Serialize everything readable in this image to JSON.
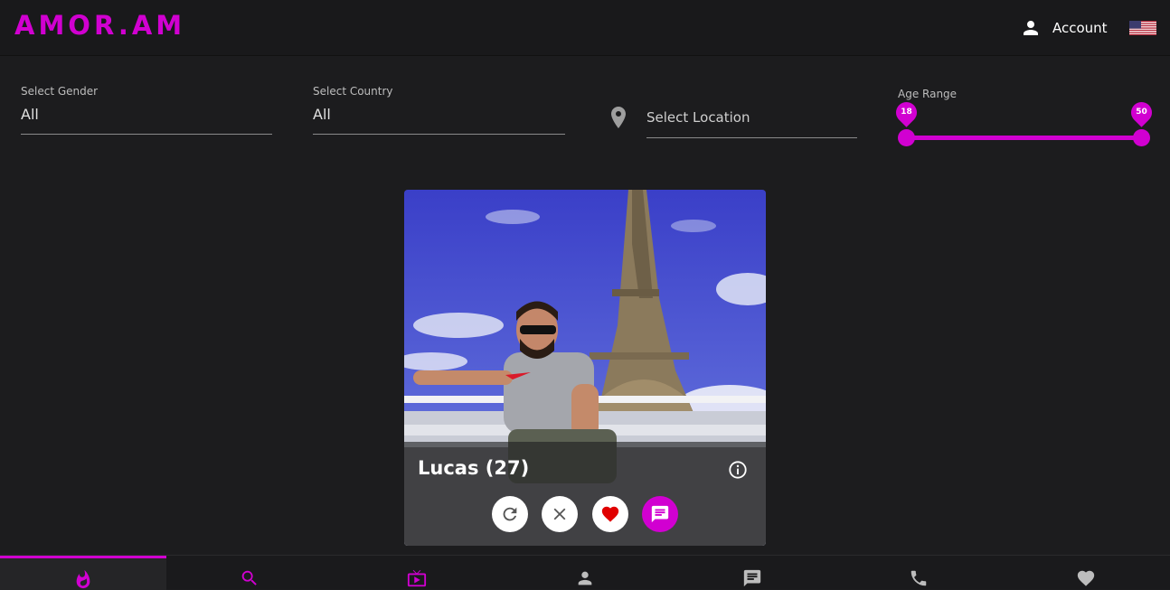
{
  "header": {
    "logo": "AMOR.AM",
    "account_label": "Account",
    "account_icon": "person-icon",
    "language_icon": "us-flag-icon"
  },
  "filters": {
    "gender": {
      "label": "Select Gender",
      "value": "All"
    },
    "country": {
      "label": "Select Country",
      "value": "All"
    },
    "location": {
      "placeholder": "Select Location",
      "icon": "location-pin-icon"
    },
    "age": {
      "label": "Age Range",
      "min": "18",
      "max": "50"
    }
  },
  "profile": {
    "name": "Lucas (27)",
    "info_icon": "info-icon",
    "actions": [
      {
        "name": "undo",
        "icon": "refresh-icon"
      },
      {
        "name": "pass",
        "icon": "close-icon"
      },
      {
        "name": "like",
        "icon": "heart-icon"
      },
      {
        "name": "message",
        "icon": "chat-icon"
      }
    ]
  },
  "bottom_nav": [
    {
      "name": "discover",
      "icon": "flame-icon",
      "active": true
    },
    {
      "name": "search",
      "icon": "search-icon",
      "active": false
    },
    {
      "name": "live",
      "icon": "tv-icon",
      "active": false
    },
    {
      "name": "profile",
      "icon": "person-icon",
      "active": false
    },
    {
      "name": "messages",
      "icon": "chat-icon",
      "active": false
    },
    {
      "name": "calls",
      "icon": "phone-icon",
      "active": false
    },
    {
      "name": "likes",
      "icon": "heart-icon",
      "active": false
    }
  ],
  "colors": {
    "accent": "#d100d1",
    "background": "#1c1c1e",
    "like_red": "#e00000"
  }
}
